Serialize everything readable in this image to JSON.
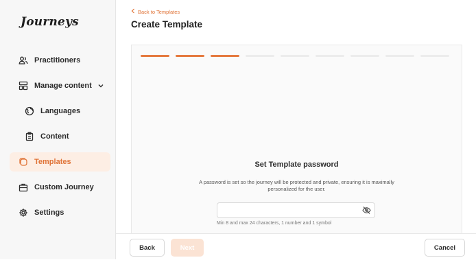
{
  "app": {
    "logo_text": "Journeys"
  },
  "sidebar": {
    "items": [
      {
        "label": "Practitioners",
        "icon": "users-icon"
      },
      {
        "label": "Manage content",
        "icon": "layout-icon"
      },
      {
        "label": "Languages",
        "icon": "globe-icon"
      },
      {
        "label": "Content",
        "icon": "clipboard-icon"
      },
      {
        "label": "Templates",
        "icon": "templates-icon",
        "active": true
      },
      {
        "label": "Custom Journey",
        "icon": "briefcase-icon"
      },
      {
        "label": "Settings",
        "icon": "gear-icon"
      }
    ]
  },
  "header": {
    "back_label": "Back to Templates",
    "title": "Create Template"
  },
  "progress": {
    "total_steps": 9,
    "completed_steps": 3
  },
  "form": {
    "title": "Set Template password",
    "description": "A password is set so the journey will be protected and private, ensuring it is maximally personalized for the user.",
    "password_value": "",
    "password_placeholder": "",
    "hint": "Min 8 and max 24 characters, 1 number and 1 symbol"
  },
  "footer": {
    "back_label": "Back",
    "next_label": "Next",
    "cancel_label": "Cancel"
  },
  "colors": {
    "accent": "#e07438",
    "accent_light": "#fdeee4",
    "progress_done": "#e57a3f",
    "progress_todo": "#ececec"
  }
}
